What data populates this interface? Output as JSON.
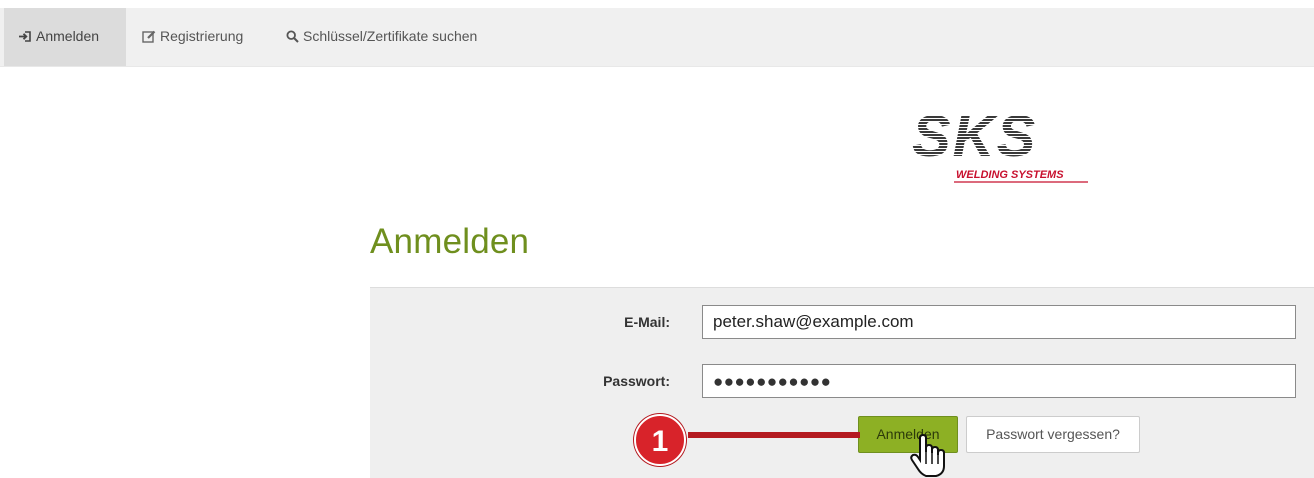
{
  "nav": {
    "items": [
      {
        "label": "Anmelden",
        "icon": "sign-in-icon",
        "active": true
      },
      {
        "label": "Registrierung",
        "icon": "edit-icon",
        "active": false
      },
      {
        "label": "Schlüssel/Zertifikate suchen",
        "icon": "search-icon",
        "active": false
      }
    ]
  },
  "logo": {
    "brand": "SKS",
    "tagline": "WELDING SYSTEMS",
    "accent_color": "#c8102e"
  },
  "page": {
    "title": "Anmelden",
    "title_color": "#6f8f1e"
  },
  "form": {
    "email_label": "E-Mail:",
    "email_value": "peter.shaw@example.com",
    "password_label": "Passwort:",
    "password_masked": "●●●●●●●●●●●",
    "login_button": "Anmelden",
    "forgot_button": "Passwort vergessen?",
    "button_color": "#8db024"
  },
  "annotation": {
    "step_number": "1",
    "color": "#d8232a"
  }
}
